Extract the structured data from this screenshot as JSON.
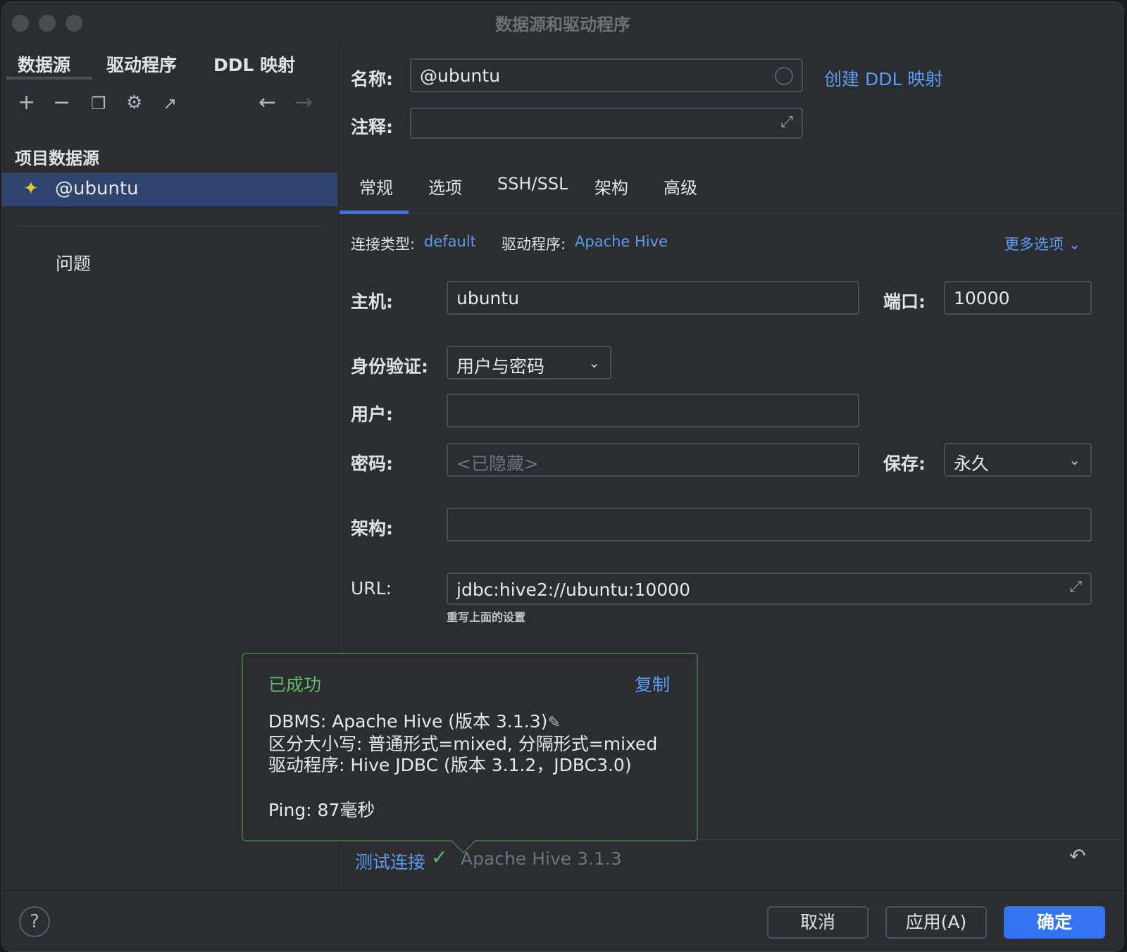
{
  "window": {
    "title": "数据源和驱动程序"
  },
  "left": {
    "tabs": [
      "数据源",
      "驱动程序",
      "DDL 映射"
    ],
    "toolbar_icons": [
      "add-icon",
      "remove-icon",
      "duplicate-icon",
      "settings-icon",
      "export-icon",
      "back-icon",
      "forward-icon"
    ],
    "section_label": "项目数据源",
    "datasource": "@ubuntu",
    "issues": "问题"
  },
  "form": {
    "name_label": "名称:",
    "name_value": "@ubuntu",
    "create_ddl_link": "创建 DDL 映射",
    "comment_label": "注释:",
    "comment_value": "",
    "tabs": [
      "常规",
      "选项",
      "SSH/SSL",
      "架构",
      "高级"
    ],
    "conn_type_label": "连接类型:",
    "conn_type_value": "default",
    "driver_label": "驱动程序:",
    "driver_value": "Apache Hive",
    "more_options": "更多选项",
    "host_label": "主机:",
    "host_value": "ubuntu",
    "port_label": "端口:",
    "port_value": "10000",
    "auth_label": "身份验证:",
    "auth_value": "用户与密码",
    "user_label": "用户:",
    "user_value": "",
    "password_label": "密码:",
    "password_placeholder": "<已隐藏>",
    "save_label": "保存:",
    "save_value": "永久",
    "schema_label": "架构:",
    "schema_value": "",
    "url_label": "URL:",
    "url_value": "jdbc:hive2://ubuntu:10000",
    "url_hint": "重写上面的设置"
  },
  "popup": {
    "status": "已成功",
    "copy": "复制",
    "dbms": "DBMS: Apache Hive (版本 3.1.3)",
    "case": "区分大小写: 普通形式=mixed, 分隔形式=mixed",
    "driver": "驱动程序: Hive JDBC (版本 3.1.2，JDBC3.0)",
    "ping": "Ping: 87毫秒"
  },
  "test": {
    "link": "测试连接",
    "result": "Apache Hive 3.1.3"
  },
  "footer": {
    "help": "?",
    "cancel": "取消",
    "apply": "应用(A)",
    "ok": "确定"
  },
  "colors": {
    "accent": "#3574f0",
    "link": "#5c9cf5",
    "success": "#5fb865",
    "selection": "#2e436e"
  }
}
